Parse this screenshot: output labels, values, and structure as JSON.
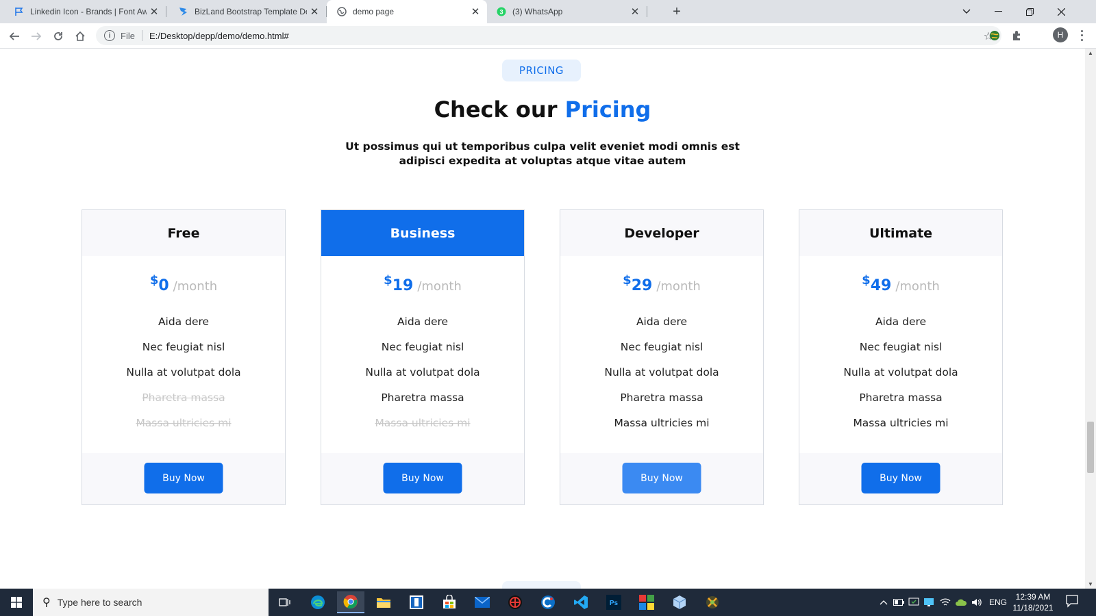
{
  "browser": {
    "tabs": [
      {
        "title": "Linkedin Icon - Brands | Font Awe",
        "favicon": "flag-icon",
        "active": false
      },
      {
        "title": "BizLand Bootstrap Template Dem",
        "favicon": "bizland-icon",
        "active": false
      },
      {
        "title": "demo page",
        "favicon": "globe-icon",
        "active": true
      },
      {
        "title": "(3) WhatsApp",
        "favicon": "whatsapp-icon",
        "active": false
      }
    ],
    "address": {
      "scheme": "File",
      "url": "E:/Desktop/depp/demo/demo.html#"
    },
    "avatar_letter": "H"
  },
  "page": {
    "badge": "PRICING",
    "title_plain": "Check our",
    "title_highlight": "Pricing",
    "description": "Ut possimus qui ut temporibus culpa velit eveniet modi omnis est adipisci expedita at voluptas atque vitae autem",
    "plans": [
      {
        "name": "Free",
        "currency": "$",
        "amount": "0",
        "period": "/month",
        "featured": false,
        "features": [
          {
            "label": "Aida dere",
            "available": true
          },
          {
            "label": "Nec feugiat nisl",
            "available": true
          },
          {
            "label": "Nulla at volutpat dola",
            "available": true
          },
          {
            "label": "Pharetra massa",
            "available": false
          },
          {
            "label": "Massa ultricies mi",
            "available": false
          }
        ],
        "button": "Buy Now"
      },
      {
        "name": "Business",
        "currency": "$",
        "amount": "19",
        "period": "/month",
        "featured": true,
        "features": [
          {
            "label": "Aida dere",
            "available": true
          },
          {
            "label": "Nec feugiat nisl",
            "available": true
          },
          {
            "label": "Nulla at volutpat dola",
            "available": true
          },
          {
            "label": "Pharetra massa",
            "available": true
          },
          {
            "label": "Massa ultricies mi",
            "available": false
          }
        ],
        "button": "Buy Now"
      },
      {
        "name": "Developer",
        "currency": "$",
        "amount": "29",
        "period": "/month",
        "featured": false,
        "features": [
          {
            "label": "Aida dere",
            "available": true
          },
          {
            "label": "Nec feugiat nisl",
            "available": true
          },
          {
            "label": "Nulla at volutpat dola",
            "available": true
          },
          {
            "label": "Pharetra massa",
            "available": true
          },
          {
            "label": "Massa ultricies mi",
            "available": true
          }
        ],
        "button": "Buy Now"
      },
      {
        "name": "Ultimate",
        "currency": "$",
        "amount": "49",
        "period": "/month",
        "featured": false,
        "features": [
          {
            "label": "Aida dere",
            "available": true
          },
          {
            "label": "Nec feugiat nisl",
            "available": true
          },
          {
            "label": "Nulla at volutpat dola",
            "available": true
          },
          {
            "label": "Pharetra massa",
            "available": true
          },
          {
            "label": "Massa ultricies mi",
            "available": true
          }
        ],
        "button": "Buy Now"
      }
    ]
  },
  "taskbar": {
    "search_placeholder": "Type here to search",
    "language": "ENG",
    "time": "12:39 AM",
    "date": "11/18/2021"
  },
  "colors": {
    "accent": "#106eea",
    "badge_bg": "#e7f1fd",
    "muted_period": "#bababa",
    "taskbar": "#1f2a3a"
  }
}
